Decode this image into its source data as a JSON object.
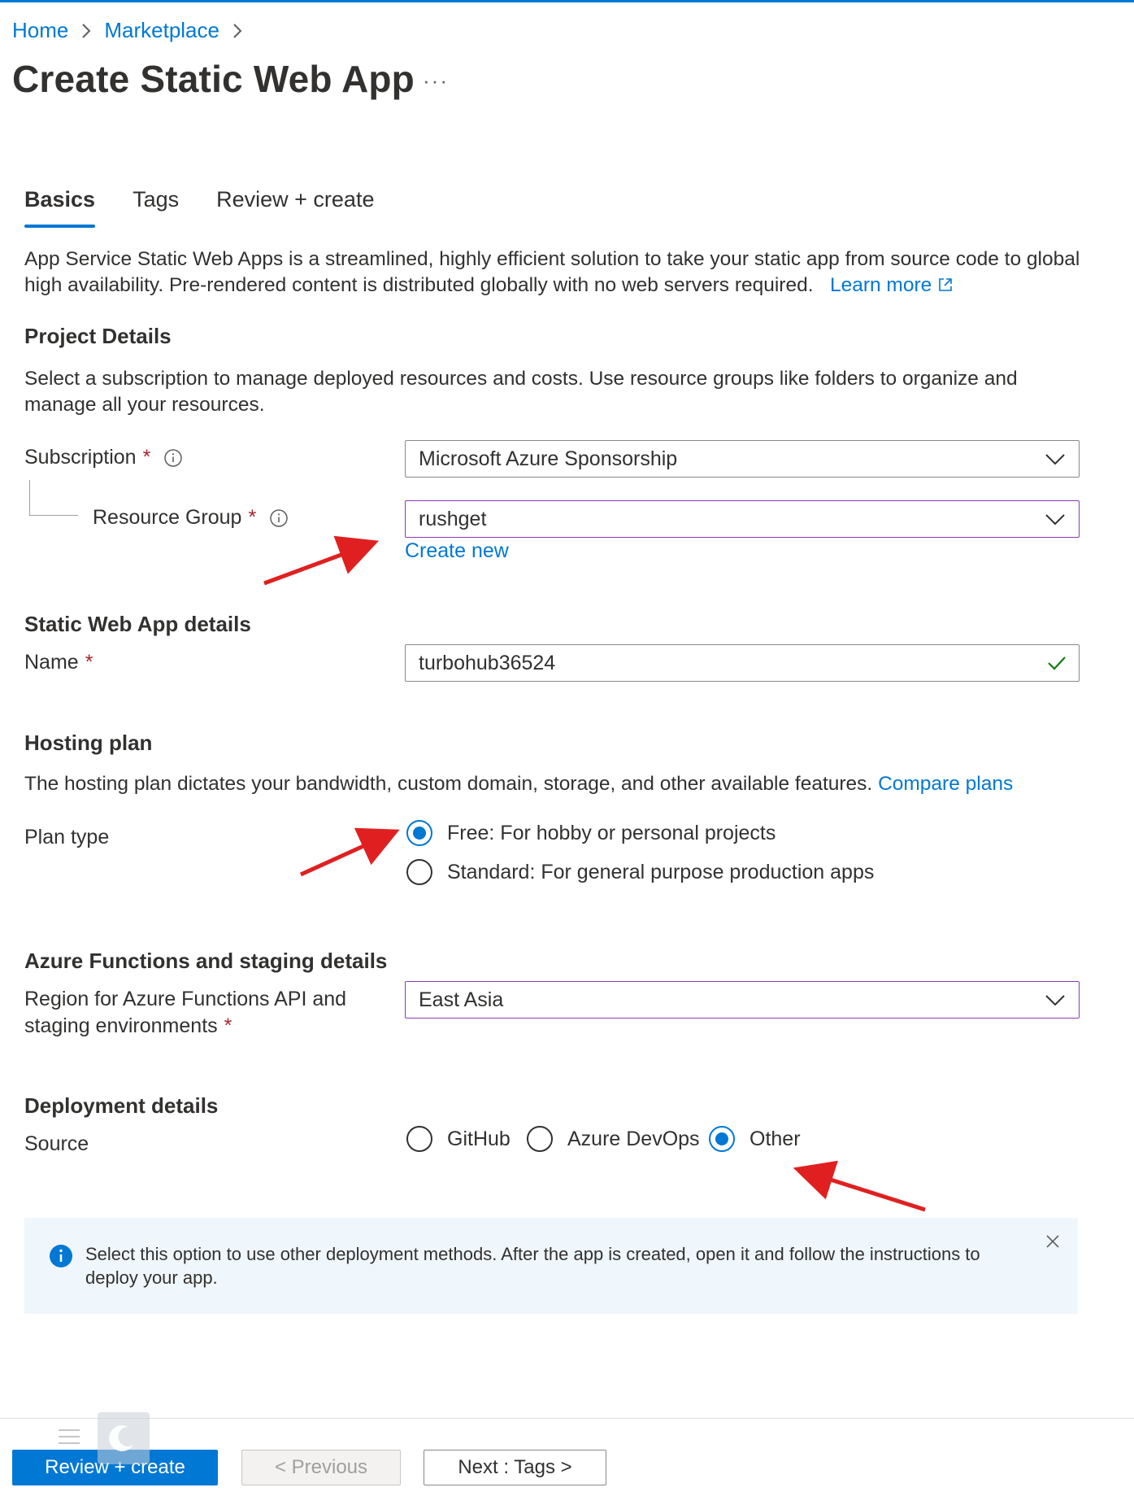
{
  "breadcrumb": {
    "home": "Home",
    "marketplace": "Marketplace"
  },
  "page": {
    "title": "Create Static Web App",
    "more": "···"
  },
  "tabs": [
    {
      "label": "Basics"
    },
    {
      "label": "Tags"
    },
    {
      "label": "Review + create"
    }
  ],
  "intro": {
    "text": "App Service Static Web Apps is a streamlined, highly efficient solution to take your static app from source code to global high availability. Pre-rendered content is distributed globally with no web servers required.",
    "learn_more": "Learn more"
  },
  "project_details": {
    "heading": "Project Details",
    "description": "Select a subscription to manage deployed resources and costs. Use resource groups like folders to organize and manage all your resources.",
    "subscription_label": "Subscription",
    "subscription_value": "Microsoft Azure Sponsorship",
    "resource_group_label": "Resource Group",
    "resource_group_value": "rushget",
    "create_new": "Create new",
    "required_mark": "*"
  },
  "app_details": {
    "heading": "Static Web App details",
    "name_label": "Name",
    "name_value": "turbohub36524"
  },
  "hosting": {
    "heading": "Hosting plan",
    "description": "The hosting plan dictates your bandwidth, custom domain, storage, and other available features.",
    "compare_plans": "Compare plans",
    "plan_type_label": "Plan type",
    "options": [
      {
        "label": "Free: For hobby or personal projects",
        "checked": true
      },
      {
        "label": "Standard: For general purpose production apps",
        "checked": false
      }
    ]
  },
  "functions": {
    "heading": "Azure Functions and staging details",
    "region_label_line1": "Region for Azure Functions API and",
    "region_label_line2": "staging environments",
    "region_value": "East Asia"
  },
  "deployment": {
    "heading": "Deployment details",
    "source_label": "Source",
    "options": [
      {
        "label": "GitHub",
        "checked": false
      },
      {
        "label": "Azure DevOps",
        "checked": false
      },
      {
        "label": "Other",
        "checked": true
      }
    ]
  },
  "info_box": {
    "text": "Select this option to use other deployment methods. After the app is created, open it and follow the instructions to deploy your app."
  },
  "footer": {
    "review_create": "Review + create",
    "previous": "< Previous",
    "next": "Next : Tags >"
  },
  "colors": {
    "accent": "#0078d4",
    "annotation_arrow": "#e02020",
    "valid_check": "#107c10",
    "focus_border": "#8a3bb5"
  }
}
